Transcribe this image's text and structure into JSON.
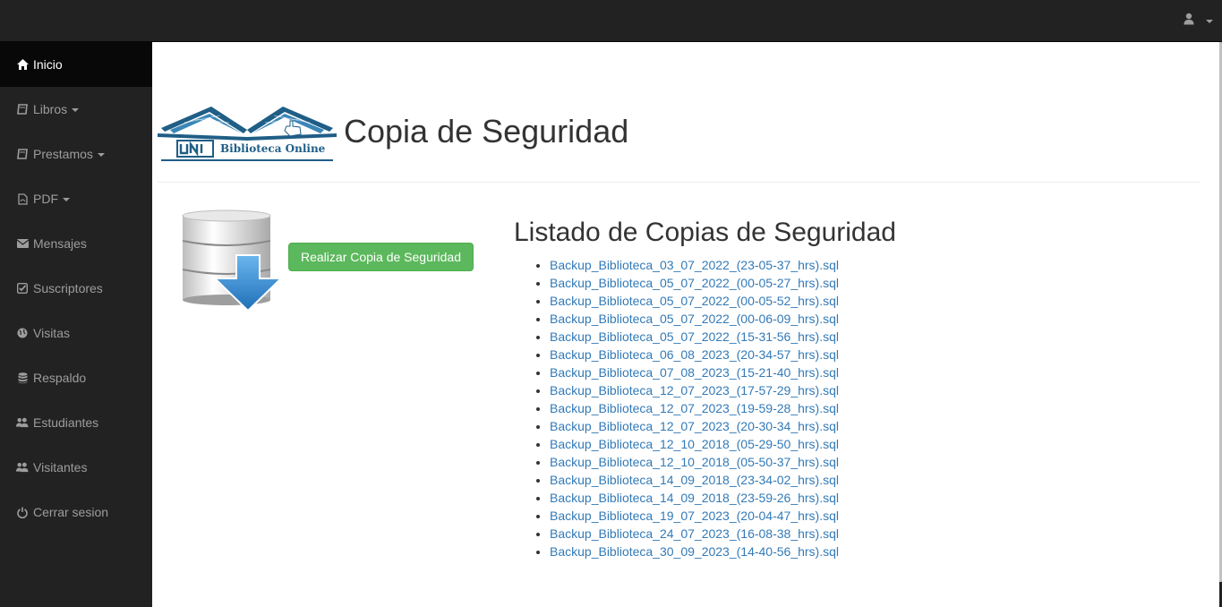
{
  "topbar": {
    "user_icon": "user-icon"
  },
  "sidebar": {
    "items": [
      {
        "label": "Inicio",
        "icon": "home-icon",
        "active": true,
        "dropdown": false
      },
      {
        "label": "Libros",
        "icon": "book-icon",
        "active": false,
        "dropdown": true
      },
      {
        "label": "Prestamos",
        "icon": "book-icon",
        "active": false,
        "dropdown": true
      },
      {
        "label": "PDF",
        "icon": "file-pdf-icon",
        "active": false,
        "dropdown": true
      },
      {
        "label": "Mensajes",
        "icon": "envelope-icon",
        "active": false,
        "dropdown": false
      },
      {
        "label": "Suscriptores",
        "icon": "check-square-icon",
        "active": false,
        "dropdown": false
      },
      {
        "label": "Visitas",
        "icon": "globe-icon",
        "active": false,
        "dropdown": false
      },
      {
        "label": "Respaldo",
        "icon": "database-icon",
        "active": false,
        "dropdown": false
      },
      {
        "label": "Estudiantes",
        "icon": "users-icon",
        "active": false,
        "dropdown": false
      },
      {
        "label": "Visitantes",
        "icon": "users-icon",
        "active": false,
        "dropdown": false
      },
      {
        "label": "Cerrar sesion",
        "icon": "power-icon",
        "active": false,
        "dropdown": false
      }
    ]
  },
  "header": {
    "title": "Copia de Seguridad",
    "logo_text": "Biblioteca Online",
    "logo_mark": "UNI"
  },
  "action": {
    "button_label": "Realizar Copia de Seguridad"
  },
  "backups": {
    "title": "Listado de Copias de Seguridad",
    "files": [
      "Backup_Biblioteca_03_07_2022_(23-05-37_hrs).sql",
      "Backup_Biblioteca_05_07_2022_(00-05-27_hrs).sql",
      "Backup_Biblioteca_05_07_2022_(00-05-52_hrs).sql",
      "Backup_Biblioteca_05_07_2022_(00-06-09_hrs).sql",
      "Backup_Biblioteca_05_07_2022_(15-31-56_hrs).sql",
      "Backup_Biblioteca_06_08_2023_(20-34-57_hrs).sql",
      "Backup_Biblioteca_07_08_2023_(15-21-40_hrs).sql",
      "Backup_Biblioteca_12_07_2023_(17-57-29_hrs).sql",
      "Backup_Biblioteca_12_07_2023_(19-59-28_hrs).sql",
      "Backup_Biblioteca_12_07_2023_(20-30-34_hrs).sql",
      "Backup_Biblioteca_12_10_2018_(05-29-50_hrs).sql",
      "Backup_Biblioteca_12_10_2018_(05-50-37_hrs).sql",
      "Backup_Biblioteca_14_09_2018_(23-34-02_hrs).sql",
      "Backup_Biblioteca_14_09_2018_(23-59-26_hrs).sql",
      "Backup_Biblioteca_19_07_2023_(20-04-47_hrs).sql",
      "Backup_Biblioteca_24_07_2023_(16-08-38_hrs).sql",
      "Backup_Biblioteca_30_09_2023_(14-40-56_hrs).sql"
    ]
  },
  "colors": {
    "navbar": "#222222",
    "active": "#080808",
    "link": "#337ab7",
    "success": "#5cb85c",
    "logo_blue": "#1f5e86"
  }
}
